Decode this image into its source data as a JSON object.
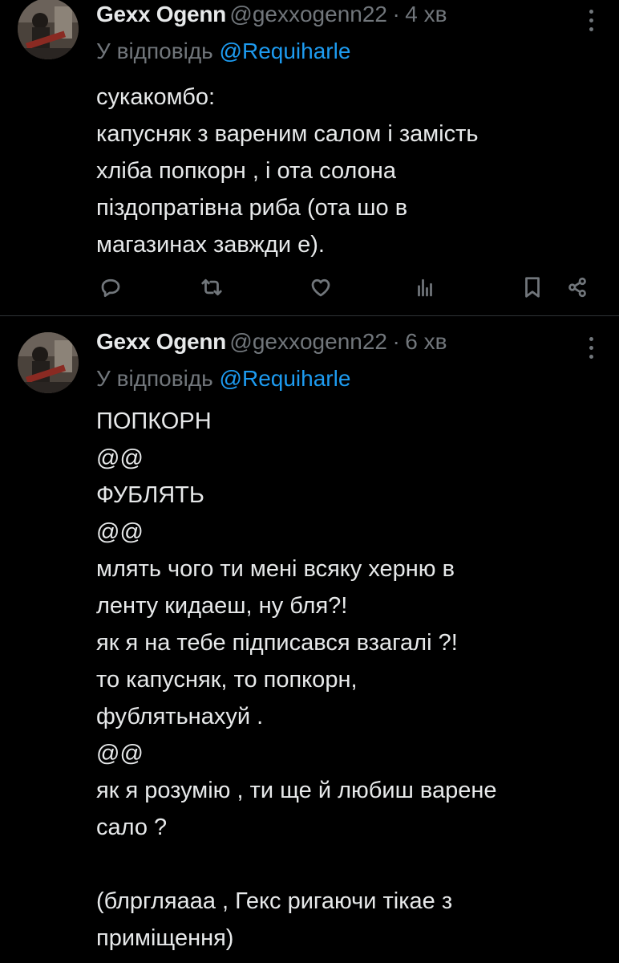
{
  "tweets": [
    {
      "name": "Gexx Ogenn",
      "handle": "@gexxogenn22",
      "separator": "·",
      "time": "4 хв",
      "reply_prefix": "У відповідь",
      "reply_to": "@Requiharle",
      "lines": [
        "сукакомбо:",
        "капусняк з вареним салом і замість",
        "хліба попкорн , і ота солона",
        "піздопратівна риба (ота шо в",
        "магазинах завжди е)."
      ],
      "actions": [
        "reply-icon",
        "retweet-icon",
        "like-icon",
        "views-icon",
        "bookmark-icon",
        "share-icon"
      ]
    },
    {
      "name": "Gexx Ogenn",
      "handle": "@gexxogenn22",
      "separator": "·",
      "time": "6 хв",
      "reply_prefix": "У відповідь",
      "reply_to": "@Requiharle",
      "lines": [
        "ПОПКОРН",
        "@@",
        "ФУБЛЯТЬ",
        "@@",
        "млять чого ти мені всяку херню в",
        "ленту кидаеш, ну бля?!",
        "як я на тебе підписався взагалі ?!",
        "то капусняк, то попкорн,",
        "фублятьнахуй .",
        "@@",
        "як я розумію , ти ще й любиш варене",
        "сало ?",
        "",
        "(блргляааа , Гекс ригаючи тікае з",
        "приміщення)"
      ]
    }
  ],
  "colors": {
    "background": "#000000",
    "text": "#e7e9ea",
    "muted": "#71767b",
    "link": "#1d9bf0",
    "divider": "#2f3336"
  }
}
